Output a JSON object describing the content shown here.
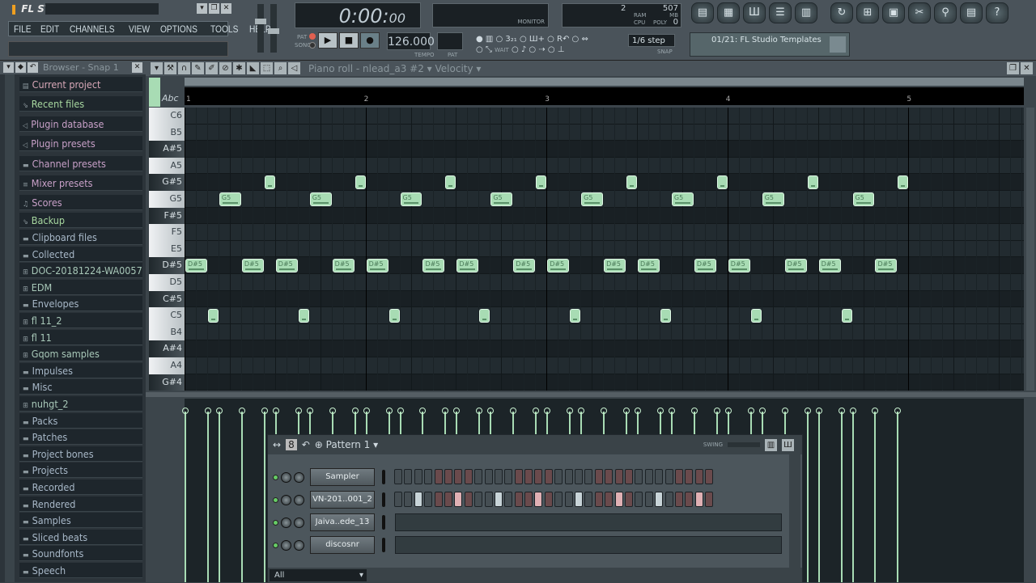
{
  "app": {
    "logo": "FL STUDIO",
    "menu": [
      "FILE",
      "EDIT",
      "CHANNELS",
      "VIEW",
      "OPTIONS",
      "TOOLS",
      "HELP"
    ]
  },
  "transport": {
    "time": "0:00",
    "time_sub": "00",
    "pat_label": "PAT",
    "song_label": "SONG",
    "tempo": "126.000",
    "tempo_label": "TEMPO",
    "pat_field_label": "PAT",
    "monitor_label": "MONITOR",
    "cpu_label": "CPU",
    "ram_label": "RAM",
    "poly_label": "POLY",
    "ram_value": "507",
    "mb_label": "MB",
    "poly_value": "0",
    "cpu_value": "2",
    "snap_value": "1/6 step",
    "snap_label": "SNAP",
    "wait_label": "WAIT"
  },
  "toolbar_buttons": [
    "playlist",
    "step-sequencer",
    "piano-roll",
    "browser",
    "mixer",
    "undo",
    "save-new",
    "render",
    "cut",
    "record-audio",
    "project-info",
    "help"
  ],
  "template": {
    "value": "01/21: FL Studio Templates"
  },
  "browser": {
    "title": "Browser - Snap 1",
    "items": [
      {
        "label": "Current project",
        "color": "#d8a8b8",
        "icon": "document"
      },
      {
        "label": "Recent files",
        "color": "#a8d8a0",
        "icon": "folder-link"
      },
      {
        "label": "Plugin database",
        "color": "#c8a0c8",
        "icon": "plugin"
      },
      {
        "label": "Plugin presets",
        "color": "#c8a0c8",
        "icon": "plugin"
      },
      {
        "label": "Channel presets",
        "color": "#c8a0c8",
        "icon": "channel"
      },
      {
        "label": "Mixer presets",
        "color": "#c8a0c8",
        "icon": "mixer"
      },
      {
        "label": "Scores",
        "color": "#c8a0c8",
        "icon": "music-note"
      },
      {
        "label": "Backup",
        "color": "#a8d8a0",
        "icon": "folder-link"
      },
      {
        "label": "Clipboard files",
        "color": "#a8b8c8",
        "icon": "folder"
      },
      {
        "label": "Collected",
        "color": "#a8b8c8",
        "icon": "folder"
      },
      {
        "label": "DOC-20181224-WA0057",
        "color": "#a8c8b8",
        "icon": "folder-plus"
      },
      {
        "label": "EDM",
        "color": "#a8c8b8",
        "icon": "folder-plus"
      },
      {
        "label": "Envelopes",
        "color": "#a8b8c8",
        "icon": "folder"
      },
      {
        "label": "fl 11_2",
        "color": "#a8c8b8",
        "icon": "folder-plus"
      },
      {
        "label": "fl 11",
        "color": "#a8c8b8",
        "icon": "folder-plus"
      },
      {
        "label": "Gqom samples",
        "color": "#a8c8b8",
        "icon": "folder-plus"
      },
      {
        "label": "Impulses",
        "color": "#a8b8c8",
        "icon": "folder"
      },
      {
        "label": "Misc",
        "color": "#a8b8c8",
        "icon": "folder"
      },
      {
        "label": "nuhgt_2",
        "color": "#a8c8b8",
        "icon": "folder-plus"
      },
      {
        "label": "Packs",
        "color": "#a8b8c8",
        "icon": "folder"
      },
      {
        "label": "Patches",
        "color": "#a8b8c8",
        "icon": "folder"
      },
      {
        "label": "Project bones",
        "color": "#a8b8c8",
        "icon": "folder"
      },
      {
        "label": "Projects",
        "color": "#a8b8c8",
        "icon": "folder"
      },
      {
        "label": "Recorded",
        "color": "#a8b8c8",
        "icon": "folder"
      },
      {
        "label": "Rendered",
        "color": "#a8b8c8",
        "icon": "folder"
      },
      {
        "label": "Samples",
        "color": "#a8b8c8",
        "icon": "folder"
      },
      {
        "label": "Sliced beats",
        "color": "#a8b8c8",
        "icon": "folder"
      },
      {
        "label": "Soundfonts",
        "color": "#a8b8c8",
        "icon": "folder"
      },
      {
        "label": "Speech",
        "color": "#a8b8c8",
        "icon": "folder"
      }
    ]
  },
  "piano_roll": {
    "title": "Piano roll - nlead_a3 #2",
    "target": "Velocity",
    "abc_label": "Abc",
    "bars": [
      "1",
      "2",
      "3",
      "4",
      "5"
    ],
    "keys": [
      "C6",
      "B5",
      "A#5",
      "A5",
      "G#5",
      "G5",
      "F#5",
      "F5",
      "E5",
      "D#5",
      "D5",
      "C#5",
      "C5",
      "B4",
      "A#4",
      "A4",
      "G#4"
    ],
    "notes": [
      {
        "pitch": "G#5",
        "length_beats": 0.25,
        "starts_beats": [
          1.75,
          3.75,
          5.75,
          7.75,
          9.75,
          11.75,
          13.75,
          15.75
        ],
        "label": ""
      },
      {
        "pitch": "G5",
        "length_beats": 0.5,
        "starts_beats": [
          0.75,
          2.75,
          4.75,
          6.75,
          8.75,
          10.75,
          12.75,
          14.75
        ],
        "label": "G5"
      },
      {
        "pitch": "D#5",
        "length_beats": 0.5,
        "starts_beats": [
          0,
          1.25,
          2,
          3.25,
          4,
          5.25,
          6,
          7.25,
          8,
          9.25,
          10,
          11.25,
          12,
          13.25,
          14,
          15.25
        ],
        "label": "D#5"
      },
      {
        "pitch": "C5",
        "length_beats": 0.25,
        "starts_beats": [
          0.5,
          2.5,
          4.5,
          6.5,
          8.5,
          10.5,
          12.5,
          14.5
        ],
        "label": ""
      }
    ],
    "note_color": "#a8dcb4"
  },
  "channel_rack": {
    "pattern": "Pattern 1",
    "swing_label": "SWING",
    "filter": "All",
    "channels": [
      {
        "name": "Sampler",
        "steps_on": [],
        "steps_accent": []
      },
      {
        "name": "VN-201..001_2",
        "steps_on": [
          3,
          11,
          19,
          27
        ],
        "steps_accent": [
          7,
          15,
          23,
          31
        ]
      },
      {
        "name": "Jaiva..ede_13",
        "piano_roll": true
      },
      {
        "name": "discosnr",
        "piano_roll": true
      }
    ]
  }
}
